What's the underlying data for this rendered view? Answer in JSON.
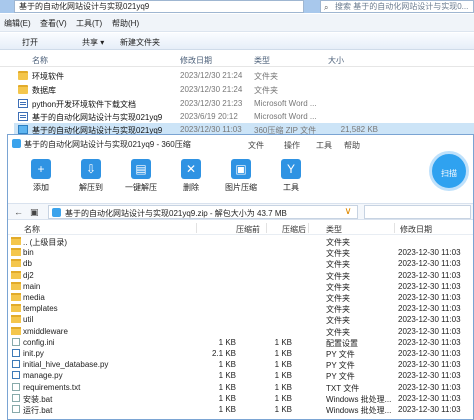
{
  "explorer": {
    "address": "基于的自动化网站设计与实现021yq9",
    "search_placeholder": "搜索 基于的自动化网站设计与实现0...",
    "menu": [
      "编辑(E)",
      "查看(V)",
      "工具(T)",
      "帮助(H)"
    ],
    "toolbar": [
      "打开",
      "共享 ▾",
      "新建文件夹"
    ],
    "columns": [
      "名称",
      "修改日期",
      "类型",
      "大小"
    ],
    "files": [
      {
        "name": "环境软件",
        "date": "2023/12/30 21:24",
        "type": "文件夹",
        "size": "",
        "icon": "folder-icon"
      },
      {
        "name": "数据库",
        "date": "2023/12/30 21:24",
        "type": "文件夹",
        "size": "",
        "icon": "folder-icon"
      },
      {
        "name": "python开发环境软件下载文档",
        "date": "2023/12/30 21:23",
        "type": "Microsoft Word ...",
        "size": "",
        "icon": "word-doc-icon"
      },
      {
        "name": "基于的自动化网站设计与实现021yq9",
        "date": "2023/6/19 20:12",
        "type": "Microsoft Word ...",
        "size": "",
        "icon": "word-doc-icon"
      },
      {
        "name": "基于的自动化网站设计与实现021yq9",
        "date": "2023/12/30 11:03",
        "type": "360压缩 ZIP 文件",
        "size": "21,582 KB",
        "icon": "zip-icon"
      }
    ]
  },
  "zip": {
    "title": "基于的自动化网站设计与实现021yq9 - 360压缩",
    "menu": [
      "文件",
      "操作",
      "工具",
      "帮助"
    ],
    "tools": [
      {
        "label": "添加",
        "icon": "add-icon"
      },
      {
        "label": "解压到",
        "icon": "extract-to-icon"
      },
      {
        "label": "一键解压",
        "icon": "one-click-extract-icon"
      },
      {
        "label": "删除",
        "icon": "delete-icon"
      },
      {
        "label": "图片压缩",
        "icon": "image-compress-icon"
      },
      {
        "label": "工具",
        "icon": "tools-icon"
      }
    ],
    "scan_label": "扫描",
    "path": "基于的自动化网站设计与实现021yq9.zip - 解包大小为 43.7 MB",
    "columns": [
      "名称",
      "压缩前",
      "压缩后",
      "类型",
      "修改日期"
    ],
    "entries": [
      {
        "name": ".. (上级目录)",
        "before": "",
        "after": "",
        "type": "文件夹",
        "date": "",
        "kind": "up"
      },
      {
        "name": "bin",
        "before": "",
        "after": "",
        "type": "文件夹",
        "date": "2023-12-30 11:03",
        "kind": "folder"
      },
      {
        "name": "db",
        "before": "",
        "after": "",
        "type": "文件夹",
        "date": "2023-12-30 11:03",
        "kind": "folder"
      },
      {
        "name": "dj2",
        "before": "",
        "after": "",
        "type": "文件夹",
        "date": "2023-12-30 11:03",
        "kind": "folder"
      },
      {
        "name": "main",
        "before": "",
        "after": "",
        "type": "文件夹",
        "date": "2023-12-30 11:03",
        "kind": "folder"
      },
      {
        "name": "media",
        "before": "",
        "after": "",
        "type": "文件夹",
        "date": "2023-12-30 11:03",
        "kind": "folder"
      },
      {
        "name": "templates",
        "before": "",
        "after": "",
        "type": "文件夹",
        "date": "2023-12-30 11:03",
        "kind": "folder"
      },
      {
        "name": "util",
        "before": "",
        "after": "",
        "type": "文件夹",
        "date": "2023-12-30 11:03",
        "kind": "folder"
      },
      {
        "name": "xmiddleware",
        "before": "",
        "after": "",
        "type": "文件夹",
        "date": "2023-12-30 11:03",
        "kind": "folder"
      },
      {
        "name": "config.ini",
        "before": "1 KB",
        "after": "1 KB",
        "type": "配置设置",
        "date": "2023-12-30 11:03",
        "kind": "file"
      },
      {
        "name": "init.py",
        "before": "2.1 KB",
        "after": "1 KB",
        "type": "PY 文件",
        "date": "2023-12-30 11:03",
        "kind": "py"
      },
      {
        "name": "initial_hive_database.py",
        "before": "1 KB",
        "after": "1 KB",
        "type": "PY 文件",
        "date": "2023-12-30 11:03",
        "kind": "py"
      },
      {
        "name": "manage.py",
        "before": "1 KB",
        "after": "1 KB",
        "type": "PY 文件",
        "date": "2023-12-30 11:03",
        "kind": "py"
      },
      {
        "name": "requirements.txt",
        "before": "1 KB",
        "after": "1 KB",
        "type": "TXT 文件",
        "date": "2023-12-30 11:03",
        "kind": "file"
      },
      {
        "name": "安装.bat",
        "before": "1 KB",
        "after": "1 KB",
        "type": "Windows 批处理...",
        "date": "2023-12-30 11:03",
        "kind": "file"
      },
      {
        "name": "运行.bat",
        "before": "1 KB",
        "after": "1 KB",
        "type": "Windows 批处理...",
        "date": "2023-12-30 11:03",
        "kind": "file"
      }
    ]
  }
}
